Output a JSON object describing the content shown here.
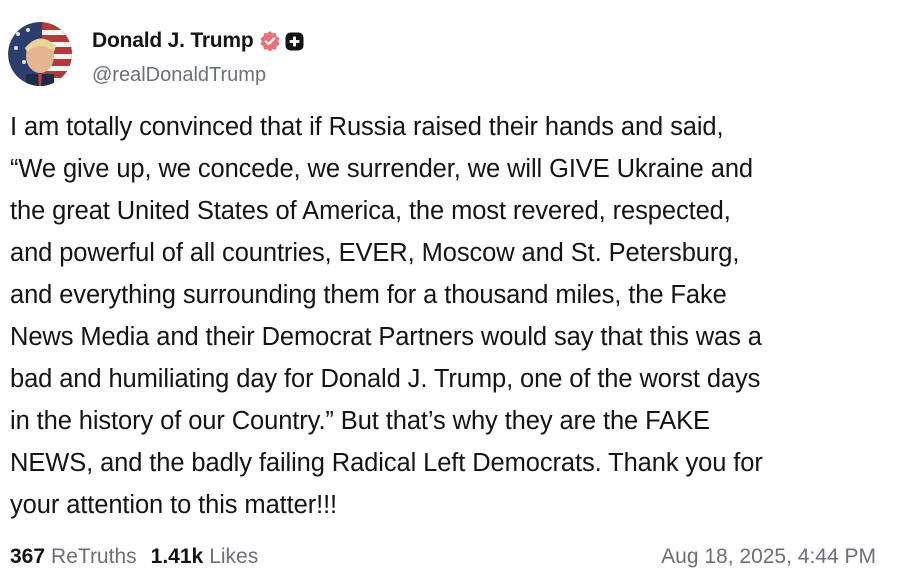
{
  "author": {
    "display_name": "Donald J. Trump",
    "handle": "@realDonaldTrump",
    "avatar_icon": "avatar-photo",
    "verified_icon": "verified-badge-icon",
    "extra_badge_icon": "plus-badge-icon"
  },
  "post": {
    "lines": [
      "I am totally convinced that if Russia raised their hands and said,",
      "“We give up, we concede, we surrender, we will GIVE Ukraine and",
      "the great United States of America, the most revered, respected,",
      "and powerful of all countries, EVER, Moscow and St. Petersburg,",
      "and everything surrounding them for a thousand miles, the Fake",
      "News Media and their Democrat Partners would say that this was a",
      "bad and humiliating day for Donald J. Trump, one of the worst days",
      "in the history of our Country.” But that’s why they are the FAKE",
      "NEWS, and the badly failing Radical Left Democrats. Thank you for",
      "your attention to this matter!!!"
    ]
  },
  "footer": {
    "retruths_count": "367",
    "retruths_label": "ReTruths",
    "likes_count": "1.41k",
    "likes_label": "Likes",
    "timestamp": "Aug 18, 2025, 4:44 PM"
  },
  "colors": {
    "text": "#141414",
    "muted": "#6b6f7a",
    "verified": "#e8707a"
  }
}
